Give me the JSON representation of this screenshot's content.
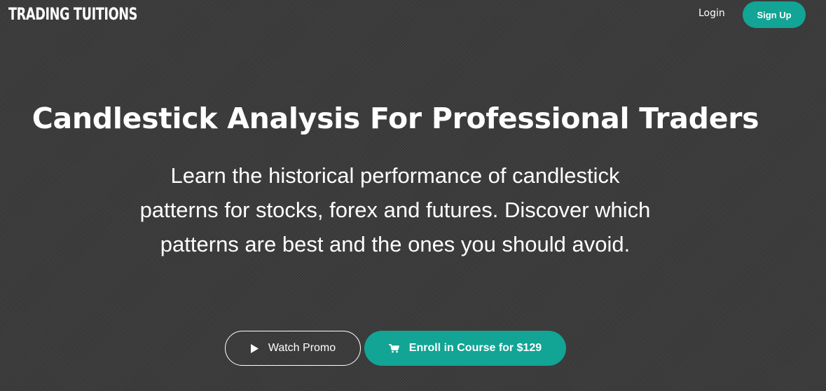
{
  "header": {
    "brand": "TRADING TUITIONS",
    "login_label": "Login",
    "signup_label": "Sign Up"
  },
  "hero": {
    "title": "Candlestick Analysis For Professional Traders",
    "subtitle": "Learn the historical performance of candlestick patterns for stocks, forex and futures. Discover which patterns are best and the ones you should avoid."
  },
  "actions": {
    "watch_label": "Watch Promo",
    "watch_icon": "play-icon",
    "enroll_label": "Enroll in Course for $129",
    "enroll_icon": "cart-icon"
  },
  "colors": {
    "accent": "#12a495",
    "background": "#3b3b3b",
    "text": "#ffffff"
  }
}
